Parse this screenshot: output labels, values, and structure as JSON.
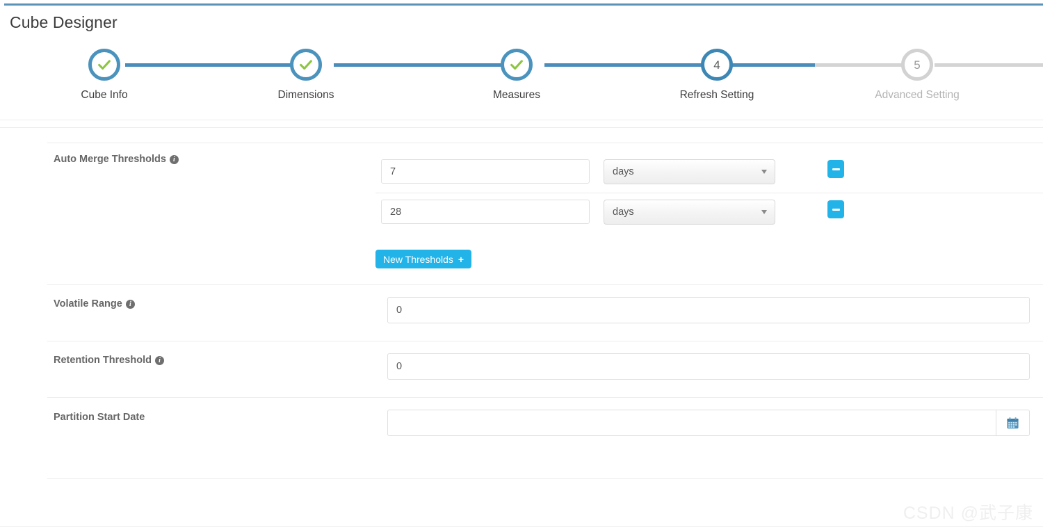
{
  "page": {
    "title": "Cube Designer",
    "watermark": "CSDN @武子康"
  },
  "stepper": {
    "steps": [
      {
        "label": "Cube Info",
        "marker": "check",
        "state": "done"
      },
      {
        "label": "Dimensions",
        "marker": "check",
        "state": "done"
      },
      {
        "label": "Measures",
        "marker": "check",
        "state": "done"
      },
      {
        "label": "Refresh Setting",
        "marker": "4",
        "state": "active"
      },
      {
        "label": "Advanced Setting",
        "marker": "5",
        "state": "todo"
      }
    ]
  },
  "form": {
    "auto_merge": {
      "label": "Auto Merge Thresholds",
      "info": "i",
      "rows": [
        {
          "value": "7",
          "unit": "days",
          "remove_label": "remove threshold"
        },
        {
          "value": "28",
          "unit": "days",
          "remove_label": "remove threshold"
        }
      ],
      "add_button": {
        "label": "New Thresholds",
        "glyph": "+"
      }
    },
    "volatile_range": {
      "label": "Volatile Range",
      "info": "i",
      "value": "0",
      "placeholder": "0"
    },
    "retention_threshold": {
      "label": "Retention Threshold",
      "info": "i",
      "value": "0",
      "placeholder": "0"
    },
    "partition_start_date": {
      "label": "Partition Start Date",
      "value": "",
      "placeholder": "",
      "calendar_icon": "calendar-icon"
    }
  },
  "colors": {
    "accent_blue": "#4b8dba",
    "action_cyan": "#22b3e8",
    "check_green": "#8cc63f",
    "muted_gray": "#d2d2d2"
  }
}
